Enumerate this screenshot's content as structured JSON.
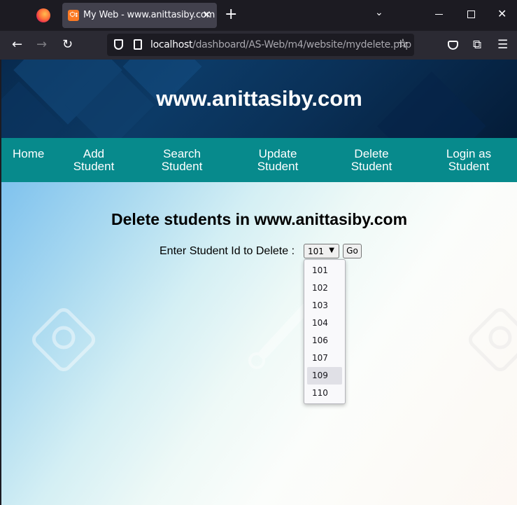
{
  "browser": {
    "tab_title": "My Web - www.anittasiby.com",
    "tab_favicon": "xampp-icon",
    "url_host": "localhost",
    "url_path": "/dashboard/AS-Web/m4/website/mydelete.php"
  },
  "site": {
    "banner_title": "www.anittasiby.com",
    "menu": [
      {
        "label": "Home"
      },
      {
        "label": "Add\nStudent"
      },
      {
        "label": "Search\nStudent"
      },
      {
        "label": "Update\nStudent"
      },
      {
        "label": "Delete\nStudent"
      },
      {
        "label": "Login as\nStudent"
      }
    ]
  },
  "form": {
    "heading": "Delete students in www.anittasiby.com",
    "label": "Enter Student Id to Delete :",
    "selected_value": "101",
    "go_label": "Go",
    "options": [
      "101",
      "102",
      "103",
      "104",
      "106",
      "107",
      "109",
      "110"
    ],
    "highlighted_option": "109"
  },
  "colors": {
    "menu_bar": "#078a8c",
    "banner": "#0c3a66",
    "browser_bg": "#1c1b22"
  }
}
